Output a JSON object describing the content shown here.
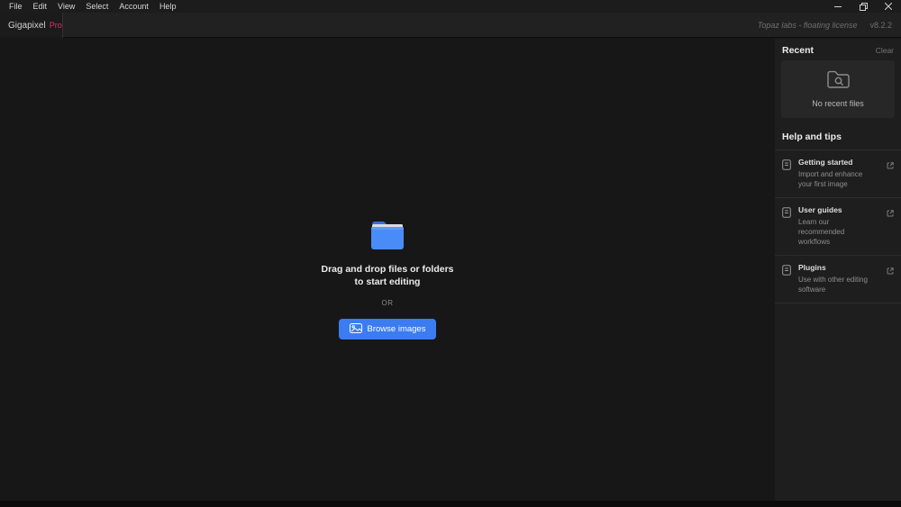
{
  "menu_bar": {
    "items": [
      "File",
      "Edit",
      "View",
      "Select",
      "Account",
      "Help"
    ]
  },
  "title_bar": {
    "app_name": "Gigapixel",
    "plan": "Pro",
    "license_text": "Topaz labs - floating license",
    "version": "v8.2.2"
  },
  "main": {
    "drop_title_line1": "Drag and drop files or folders",
    "drop_title_line2": "to start editing",
    "or_label": "OR",
    "browse_label": "Browse images"
  },
  "sidebar": {
    "recent": {
      "title": "Recent",
      "clear_label": "Clear",
      "empty_text": "No recent files"
    },
    "help": {
      "title": "Help and tips",
      "items": [
        {
          "title": "Getting started",
          "description": "Import and enhance your first image"
        },
        {
          "title": "User guides",
          "description": "Learn our recommended workflows"
        },
        {
          "title": "Plugins",
          "description": "Use with other editing software"
        }
      ]
    }
  },
  "icons": {
    "folder": "blue-folder-icon",
    "folder_search": "folder-search-icon",
    "image": "image-icon",
    "document": "document-icon",
    "external_link": "external-link-icon"
  },
  "colors": {
    "accent_blue": "#3b7cf0",
    "brand_pink": "#e0316e",
    "main_bg": "#171717",
    "sidebar_bg": "#1e1e1e",
    "panel_bg": "#272727"
  }
}
